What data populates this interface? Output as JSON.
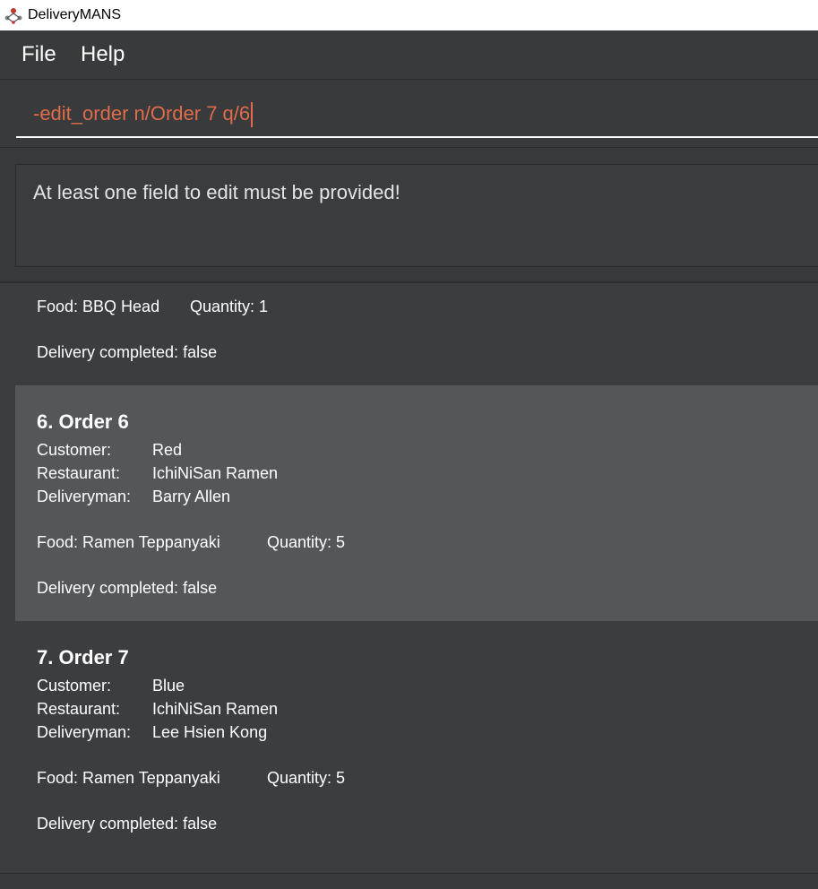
{
  "window": {
    "title": "DeliveryMANS",
    "icon": "delivery-app-icon"
  },
  "menu": {
    "file_label": "File",
    "help_label": "Help"
  },
  "command_box": {
    "value": "-edit_order n/Order 7 q/6"
  },
  "result_display": {
    "text": "At least one field to edit must be provided!"
  },
  "orders": {
    "partial": {
      "food": "Food: BBQ Head",
      "quantity": "Quantity: 1",
      "delivery": "Delivery completed: false"
    },
    "items": [
      {
        "title": "6.  Order 6",
        "customer_label": "Customer:",
        "customer": "Red",
        "restaurant_label": "Restaurant:",
        "restaurant": "IchiNiSan Ramen",
        "deliveryman_label": "Deliveryman:",
        "deliveryman": "Barry Allen",
        "food": "Food: Ramen Teppanyaki",
        "quantity": "Quantity: 5",
        "delivery": "Delivery completed: false"
      },
      {
        "title": "7.  Order 7",
        "customer_label": "Customer:",
        "customer": "Blue",
        "restaurant_label": "Restaurant:",
        "restaurant": "IchiNiSan Ramen",
        "deliveryman_label": "Deliveryman:",
        "deliveryman": "Lee Hsien Kong",
        "food": "Food: Ramen Teppanyaki",
        "quantity": "Quantity: 5",
        "delivery": "Delivery completed: false"
      }
    ]
  },
  "colors": {
    "background": "#3c3d3f",
    "selected_card": "#53575a",
    "command_text": "#e06c4c",
    "text": "#ffffff"
  }
}
